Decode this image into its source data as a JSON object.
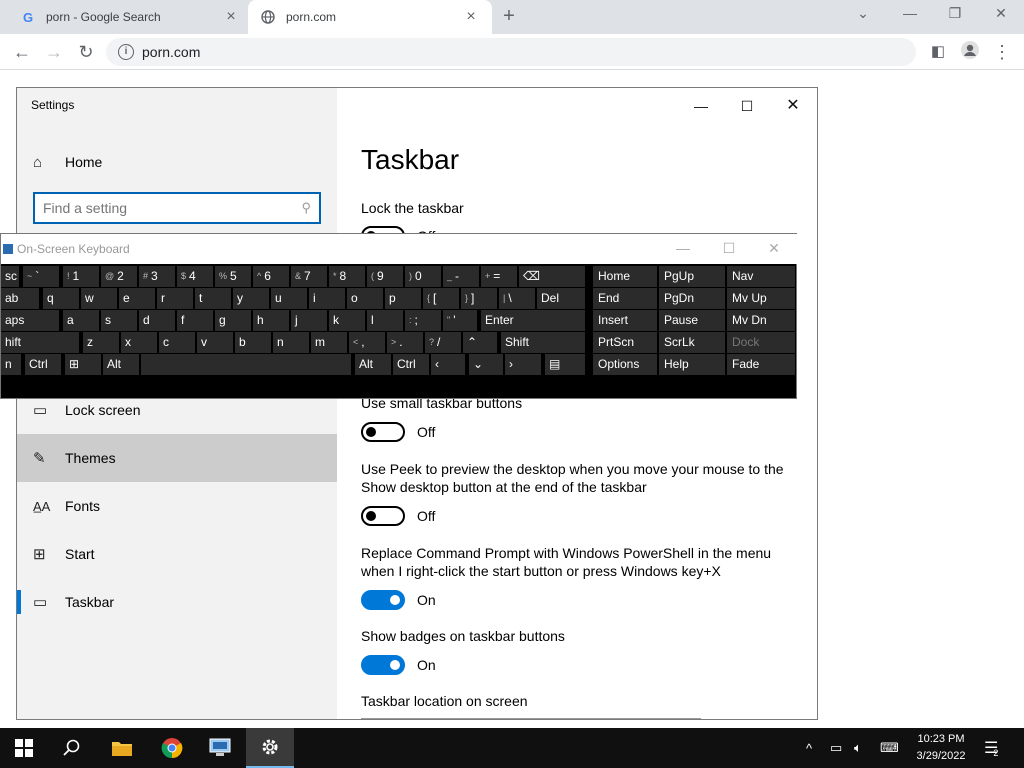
{
  "browser": {
    "tabs": [
      {
        "title": "porn - Google Search",
        "favicon": "G",
        "close": "×"
      },
      {
        "title": "porn.com",
        "favicon": "globe-icon",
        "close": "×"
      }
    ],
    "new_tab": "+",
    "window_controls": [
      "⌄",
      "—",
      "❐",
      "✕"
    ],
    "url": "porn.com"
  },
  "settings": {
    "window_title": "Settings",
    "home_label": "Home",
    "search_placeholder": "Find a setting",
    "sidebar_items": [
      {
        "label": "Lock screen",
        "icon": "lock-screen-icon"
      },
      {
        "label": "Themes",
        "icon": "themes-icon"
      },
      {
        "label": "Fonts",
        "icon": "fonts-icon"
      },
      {
        "label": "Start",
        "icon": "start-icon"
      },
      {
        "label": "Taskbar",
        "icon": "taskbar-icon"
      }
    ],
    "page_title": "Taskbar",
    "options": [
      {
        "label": "Lock the taskbar",
        "state": "Off",
        "on": false
      },
      {
        "label": "Use small taskbar buttons",
        "state": "Off",
        "on": false
      },
      {
        "label": "Use Peek to preview the desktop when you move your mouse to the Show desktop button at the end of the taskbar",
        "state": "Off",
        "on": false
      },
      {
        "label": "Replace Command Prompt with Windows PowerShell in the menu when I right-click the start button or press Windows key+X",
        "state": "On",
        "on": true
      },
      {
        "label": "Show badges on taskbar buttons",
        "state": "On",
        "on": true
      }
    ],
    "location_label": "Taskbar location on screen"
  },
  "osk": {
    "title": "On-Screen Keyboard",
    "row1": [
      {
        "s": "",
        "m": "sc"
      },
      {
        "s": "~",
        "m": "`"
      },
      {
        "s": "!",
        "m": "1"
      },
      {
        "s": "@",
        "m": "2"
      },
      {
        "s": "#",
        "m": "3"
      },
      {
        "s": "$",
        "m": "4"
      },
      {
        "s": "%",
        "m": "5"
      },
      {
        "s": "^",
        "m": "6"
      },
      {
        "s": "&",
        "m": "7"
      },
      {
        "s": "*",
        "m": "8"
      },
      {
        "s": "(",
        "m": "9"
      },
      {
        "s": ")",
        "m": "0"
      },
      {
        "s": "_",
        "m": "-"
      },
      {
        "s": "+",
        "m": "="
      },
      {
        "s": "",
        "m": "⌫"
      }
    ],
    "row2": [
      {
        "s": "",
        "m": "ab"
      },
      {
        "s": "",
        "m": "q"
      },
      {
        "s": "",
        "m": "w"
      },
      {
        "s": "",
        "m": "e"
      },
      {
        "s": "",
        "m": "r"
      },
      {
        "s": "",
        "m": "t"
      },
      {
        "s": "",
        "m": "y"
      },
      {
        "s": "",
        "m": "u"
      },
      {
        "s": "",
        "m": "i"
      },
      {
        "s": "",
        "m": "o"
      },
      {
        "s": "",
        "m": "p"
      },
      {
        "s": "{",
        "m": "["
      },
      {
        "s": "}",
        "m": "]"
      },
      {
        "s": "|",
        "m": "\\"
      },
      {
        "s": "",
        "m": "Del"
      }
    ],
    "row3": [
      {
        "s": "",
        "m": "aps"
      },
      {
        "s": "",
        "m": "a"
      },
      {
        "s": "",
        "m": "s"
      },
      {
        "s": "",
        "m": "d"
      },
      {
        "s": "",
        "m": "f"
      },
      {
        "s": "",
        "m": "g"
      },
      {
        "s": "",
        "m": "h"
      },
      {
        "s": "",
        "m": "j"
      },
      {
        "s": "",
        "m": "k"
      },
      {
        "s": "",
        "m": "l"
      },
      {
        "s": ":",
        "m": ";"
      },
      {
        "s": "\"",
        "m": "'"
      },
      {
        "s": "",
        "m": "Enter"
      }
    ],
    "row4": [
      {
        "s": "",
        "m": "hift"
      },
      {
        "s": "",
        "m": "z"
      },
      {
        "s": "",
        "m": "x"
      },
      {
        "s": "",
        "m": "c"
      },
      {
        "s": "",
        "m": "v"
      },
      {
        "s": "",
        "m": "b"
      },
      {
        "s": "",
        "m": "n"
      },
      {
        "s": "",
        "m": "m"
      },
      {
        "s": "<",
        "m": ","
      },
      {
        "s": ">",
        "m": "."
      },
      {
        "s": "?",
        "m": "/"
      },
      {
        "s": "",
        "m": "⌃"
      },
      {
        "s": "",
        "m": "Shift"
      }
    ],
    "row5": [
      {
        "s": "",
        "m": "n"
      },
      {
        "s": "",
        "m": "Ctrl"
      },
      {
        "s": "",
        "m": "⊞"
      },
      {
        "s": "",
        "m": "Alt"
      },
      {
        "s": "",
        "m": ""
      },
      {
        "s": "",
        "m": "Alt"
      },
      {
        "s": "",
        "m": "Ctrl"
      },
      {
        "s": "",
        "m": "‹"
      },
      {
        "s": "",
        "m": "⌄"
      },
      {
        "s": "",
        "m": "›"
      },
      {
        "s": "",
        "m": "▤"
      }
    ],
    "nav_keys": [
      [
        "Home",
        "PgUp",
        "Nav"
      ],
      [
        "End",
        "PgDn",
        "Mv Up"
      ],
      [
        "Insert",
        "Pause",
        "Mv Dn"
      ],
      [
        "PrtScn",
        "ScrLk",
        "Dock"
      ],
      [
        "Options",
        "Help",
        "Fade"
      ]
    ]
  },
  "taskbar": {
    "time": "10:23 PM",
    "date": "3/29/2022",
    "notification_count": "2"
  }
}
